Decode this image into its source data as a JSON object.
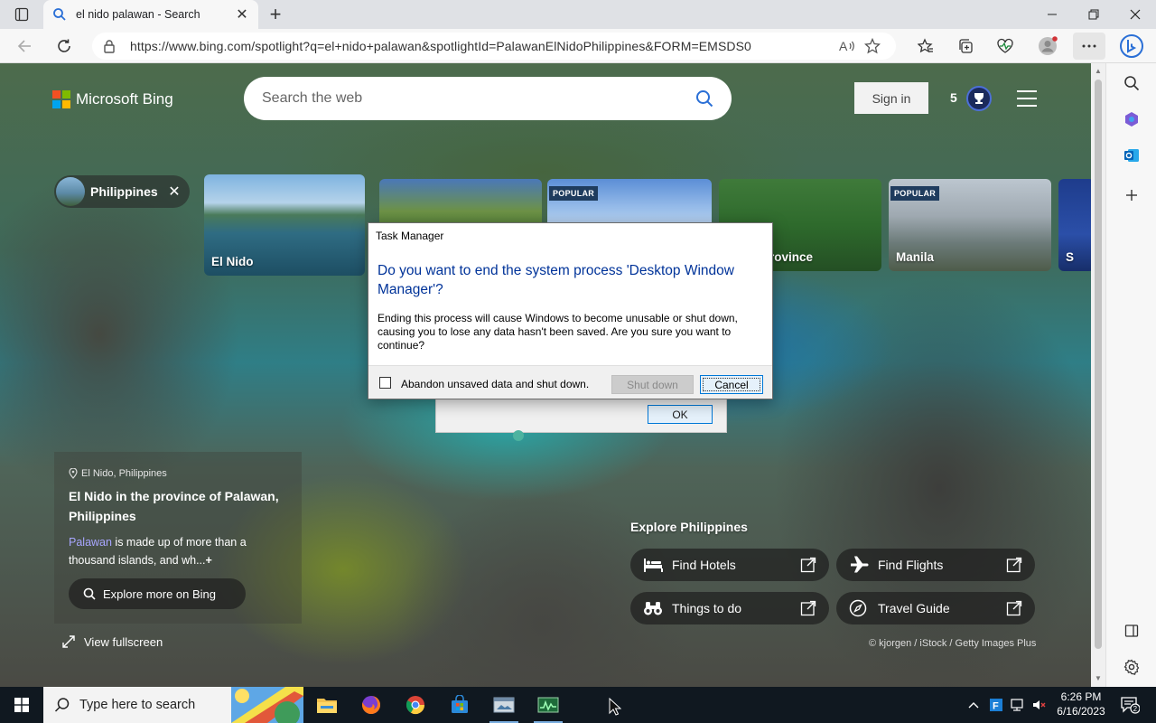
{
  "browser": {
    "tab": {
      "title": "el nido palawan - Search"
    },
    "url": "https://www.bing.com/spotlight?q=el+nido+palawan&spotlightId=PalawanElNidoPhilippines&FORM=EMSDS0"
  },
  "bing": {
    "logo_text": "Microsoft Bing",
    "search_placeholder": "Search the web",
    "sign_in": "Sign in",
    "rewards_count": "5",
    "chip_label": "Philippines",
    "cards": [
      {
        "caption": "El Nido",
        "badge": ""
      },
      {
        "caption": "",
        "badge": ""
      },
      {
        "caption": "",
        "badge": "POPULAR"
      },
      {
        "caption": "rovince",
        "badge": ""
      },
      {
        "caption": "Manila",
        "badge": "POPULAR"
      },
      {
        "caption": "S",
        "badge": ""
      }
    ],
    "location": "El Nido, Philippines",
    "info_title": "El Nido in the province of Palawan, Philippines",
    "info_link": "Palawan",
    "info_desc": " is made up of more than a thousand islands, and wh...",
    "info_more": "+",
    "explore_more": "Explore more on Bing",
    "view_fullscreen": "View fullscreen",
    "explore_title": "Explore Philippines",
    "explore_buttons": [
      {
        "label": "Find Hotels",
        "icon": "bed-icon"
      },
      {
        "label": "Find Flights",
        "icon": "plane-icon"
      },
      {
        "label": "Things to do",
        "icon": "binoculars-icon"
      },
      {
        "label": "Travel Guide",
        "icon": "compass-icon"
      }
    ],
    "credit": "© kjorgen / iStock / Getty Images Plus"
  },
  "behind_dialog": {
    "ok": "OK"
  },
  "dialog": {
    "title": "Task Manager",
    "question": "Do you want to end the system process 'Desktop Window Manager'?",
    "message": "Ending this process will cause Windows to become unusable or shut down, causing you to lose any data hasn't been saved. Are you sure you want to continue?",
    "checkbox_label": "Abandon unsaved data and shut down.",
    "shutdown": "Shut down",
    "cancel": "Cancel"
  },
  "taskbar": {
    "search_placeholder": "Type here to search",
    "time": "6:26 PM",
    "date": "6/16/2023",
    "notification_count": "2"
  },
  "colors": {
    "dialog_question": "#003399",
    "bing_link": "#a8a6ff",
    "popular_badge": "#1f3c5e",
    "ms_red": "#f25022",
    "ms_green": "#7fba00",
    "ms_blue": "#00a4ef",
    "ms_yellow": "#ffb900"
  }
}
